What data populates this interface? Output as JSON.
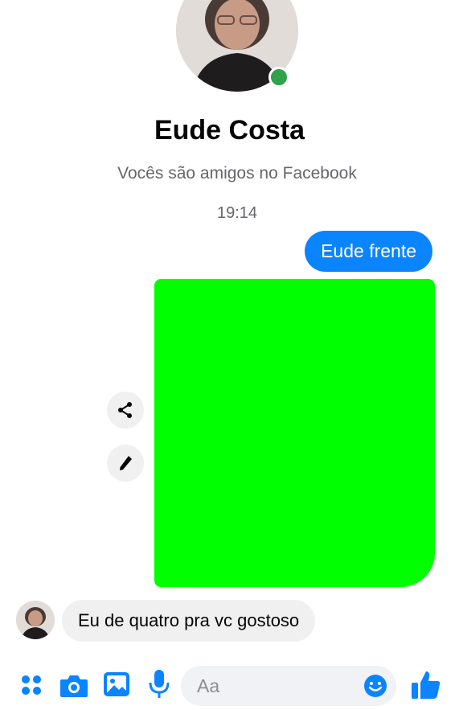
{
  "contact": {
    "name": "Eude Costa",
    "relationship": "Vocês são amigos no Facebook",
    "online": true
  },
  "thread": {
    "timestamp": "19:14",
    "messages": [
      {
        "direction": "sent",
        "text": "Eude frente"
      },
      {
        "direction": "sent",
        "type": "image"
      },
      {
        "direction": "received",
        "text": "Eu de quatro pra vc gostoso"
      }
    ]
  },
  "composer": {
    "placeholder": "Aa",
    "icons": [
      "apps-icon",
      "camera-icon",
      "gallery-icon",
      "microphone-icon",
      "emoji-icon",
      "thumbs-up-icon"
    ]
  },
  "colors": {
    "accent": "#0a84ff",
    "online": "#31a24c",
    "media_placeholder": "#00ff00"
  }
}
